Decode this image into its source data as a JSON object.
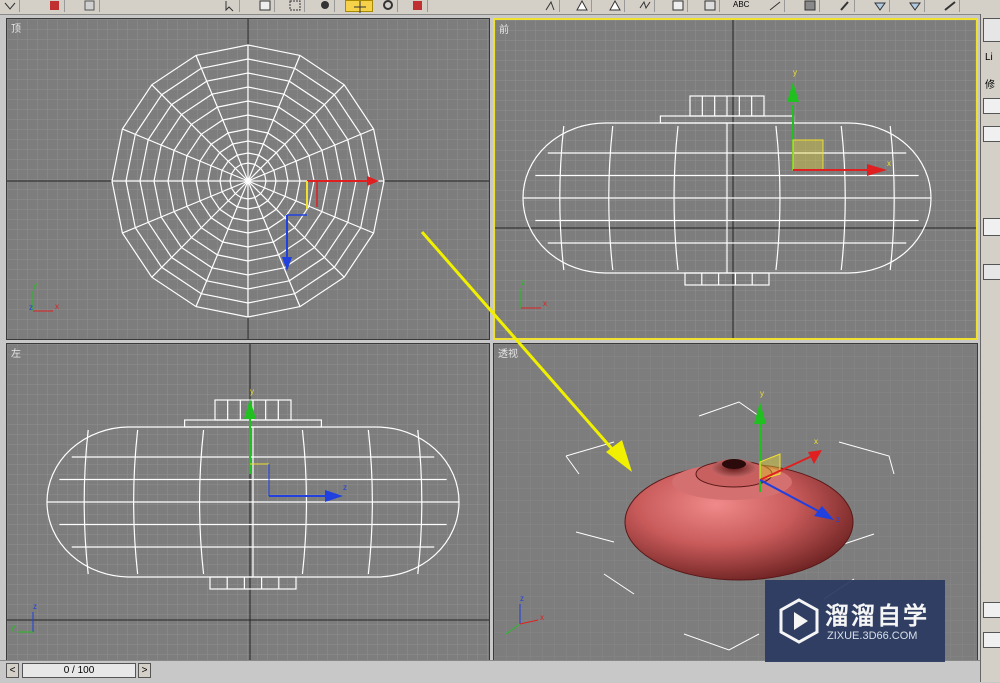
{
  "viewports": {
    "top": {
      "label": "顶"
    },
    "front": {
      "label": "前"
    },
    "left": {
      "label": "左"
    },
    "perspective": {
      "label": "透视"
    }
  },
  "axes": {
    "x": "x",
    "y": "y",
    "z": "z"
  },
  "toolbar": {
    "abc_label": "ABC"
  },
  "command_panel": {
    "item1": "Li",
    "item2": "修"
  },
  "timeline": {
    "slider_text": "0 / 100",
    "prev": "<",
    "next": ">"
  },
  "logo": {
    "title": "溜溜自学",
    "url": "ZIXUE.3D66.COM"
  },
  "colors": {
    "viewport_bg": "#7d7d7d",
    "active_border": "#f0e030",
    "wire": "#ffffff",
    "object_red": "#c85a5a",
    "gizmo_x": "#e02020",
    "gizmo_y": "#20c020",
    "gizmo_z": "#2040e0",
    "annotation_arrow": "#f0f000"
  }
}
